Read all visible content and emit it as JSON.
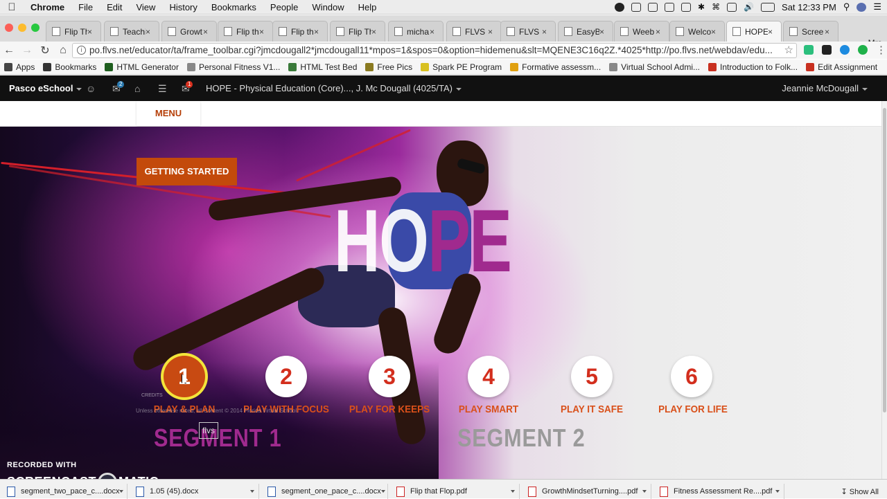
{
  "menubar": {
    "app": "Chrome",
    "items": [
      "File",
      "Edit",
      "View",
      "History",
      "Bookmarks",
      "People",
      "Window",
      "Help"
    ],
    "clock": "Sat 12:33 PM"
  },
  "browser": {
    "tabs": [
      {
        "label": "Flip Th",
        "active": false
      },
      {
        "label": "Teachi",
        "active": false
      },
      {
        "label": "Growt",
        "active": false
      },
      {
        "label": "Flip th",
        "active": false
      },
      {
        "label": "Flip th",
        "active": false
      },
      {
        "label": "Flip Th",
        "active": false
      },
      {
        "label": "micha",
        "active": false
      },
      {
        "label": "FLVS",
        "active": false
      },
      {
        "label": "FLVS -",
        "active": false
      },
      {
        "label": "EasyB",
        "active": false
      },
      {
        "label": "Weeb",
        "active": false
      },
      {
        "label": "Welco",
        "active": false
      },
      {
        "label": "HOPE",
        "active": true
      },
      {
        "label": "Scree",
        "active": false
      }
    ],
    "tab_close": "×",
    "profile": "Mrs.",
    "url": "po.flvs.net/educator/ta/frame_toolbar.cgi?jmcdougall2*jmcdougall11*mpos=1&spos=0&option=hidemenu&slt=MQENE3C16q2Z.*4025*http://po.flvs.net/webdav/edu...",
    "bookmarks": [
      {
        "label": "Apps",
        "icon_color": "#444444"
      },
      {
        "label": "Bookmarks",
        "icon_color": "#333333"
      },
      {
        "label": "HTML Generator",
        "icon_color": "#1e5e1e"
      },
      {
        "label": "Personal Fitness V1...",
        "icon_color": "#888888"
      },
      {
        "label": "HTML Test Bed",
        "icon_color": "#3a7a3a"
      },
      {
        "label": "Free Pics",
        "icon_color": "#8a7a20"
      },
      {
        "label": "Spark PE Program",
        "icon_color": "#d8c020"
      },
      {
        "label": "Formative assessm...",
        "icon_color": "#e0a010"
      },
      {
        "label": "Virtual School Admi...",
        "icon_color": "#888888"
      },
      {
        "label": "Introduction to Folk...",
        "icon_color": "#c83020"
      },
      {
        "label": "Edit Assignment",
        "icon_color": "#c83020"
      }
    ]
  },
  "lms": {
    "school": "Pasco eSchool",
    "course": "HOPE - Physical Education (Core)..., J. Mc Dougall (4025/TA)",
    "user": "Jeannie McDougall",
    "badge_groups": "2",
    "badge_mail": "1"
  },
  "course": {
    "menu_label": "MENU",
    "getting_started": "GETTING STARTED",
    "hero_title_a": "HO",
    "hero_title_b": "PE",
    "modules": [
      {
        "num": "1",
        "label": "PLAY & PLAN",
        "selected": true
      },
      {
        "num": "2",
        "label": "PLAY WITH FOCUS",
        "selected": false
      },
      {
        "num": "3",
        "label": "PLAY FOR KEEPS",
        "selected": false
      },
      {
        "num": "4",
        "label": "PLAY SMART",
        "selected": false
      },
      {
        "num": "5",
        "label": "PLAY IT SAFE",
        "selected": false
      },
      {
        "num": "6",
        "label": "PLAY FOR LIFE",
        "selected": false
      }
    ],
    "segment1": "SEGMENT 1",
    "segment2": "SEGMENT 2",
    "flvs_logo": "flvs",
    "copyright": "Unless otherwise noted, all Content © 2014 Florida Virtual School.",
    "credits": "CREDITS",
    "colors": {
      "accent": "#c34a0b",
      "module_red": "#d32e1d",
      "label_orange": "#d9501a",
      "segment1": "#a02a8e",
      "segment2": "#9a9a9a"
    }
  },
  "watermark": {
    "line1": "RECORDED WITH",
    "line2a": "SCREENCAST",
    "line2b": "MATIC"
  },
  "downloads": {
    "items": [
      {
        "name": "segment_two_pace_c....docx",
        "type": "doc"
      },
      {
        "name": "1.05 (45).docx",
        "type": "doc"
      },
      {
        "name": "segment_one_pace_c....docx",
        "type": "doc"
      },
      {
        "name": "Flip that Flop.pdf",
        "type": "pdf"
      },
      {
        "name": "GrowthMindsetTurning....pdf",
        "type": "pdf"
      },
      {
        "name": "Fitness Assessment Re....pdf",
        "type": "pdf"
      }
    ],
    "show_all": "Show All"
  }
}
